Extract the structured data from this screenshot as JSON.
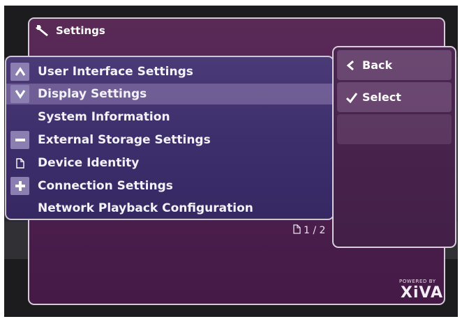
{
  "window": {
    "title": "Settings",
    "title_icon": "wrench-icon"
  },
  "menu": {
    "items": [
      {
        "label": "User Interface Settings",
        "icon": "chevron-up-icon",
        "selected": false
      },
      {
        "label": "Display Settings",
        "icon": "chevron-down-icon",
        "selected": true
      },
      {
        "label": "System Information",
        "icon": "",
        "selected": false
      },
      {
        "label": "External Storage Settings",
        "icon": "minus-icon",
        "selected": false
      },
      {
        "label": "Device Identity",
        "icon": "page-icon",
        "selected": false
      },
      {
        "label": "Connection Settings",
        "icon": "plus-icon",
        "selected": false
      },
      {
        "label": "Network Playback Configuration",
        "icon": "",
        "selected": false
      }
    ]
  },
  "side": {
    "back_label": "Back",
    "select_label": "Select"
  },
  "pagination": {
    "text": "1 / 2",
    "current": 1,
    "total": 2
  },
  "branding": {
    "powered_by": "POWERED BY",
    "logo_text": "XiVA"
  },
  "colors": {
    "panel": "#4f2150",
    "list_panel": "#3d2f6c",
    "badge": "#8a7fb0",
    "border": "#d5cbd8"
  }
}
